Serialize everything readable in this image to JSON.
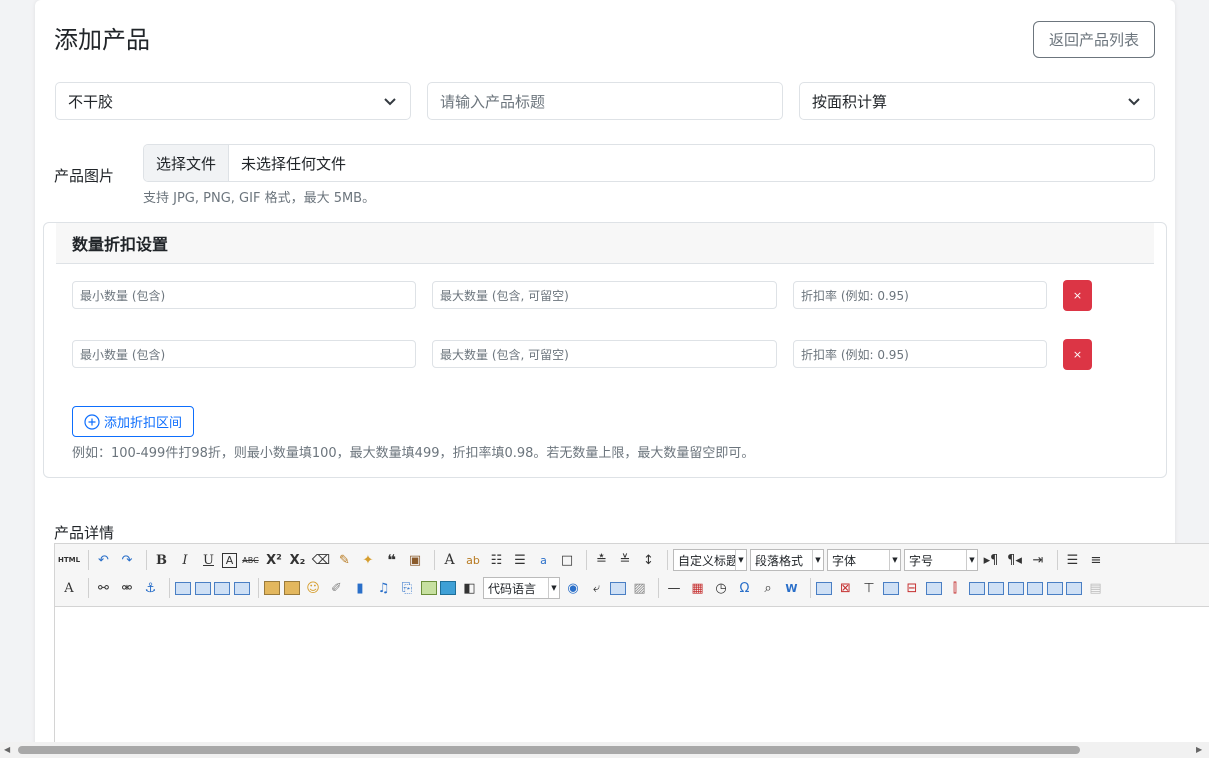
{
  "page": {
    "title": "添加产品",
    "back_button": "返回产品列表"
  },
  "form": {
    "category_select": "不干胶",
    "title_input_placeholder": "请输入产品标题",
    "pricing_select": "按面积计算",
    "image_label": "产品图片",
    "file_button": "选择文件",
    "file_status": "未选择任何文件",
    "file_hint": "支持 JPG, PNG, GIF 格式，最大 5MB。"
  },
  "discount": {
    "header": "数量折扣设置",
    "rows": [
      {
        "min_placeholder": "最小数量 (包含)",
        "max_placeholder": "最大数量 (包含, 可留空)",
        "rate_placeholder": "折扣率 (例如: 0.95)",
        "delete": "×"
      },
      {
        "min_placeholder": "最小数量 (包含)",
        "max_placeholder": "最大数量 (包含, 可留空)",
        "rate_placeholder": "折扣率 (例如: 0.95)",
        "delete": "×"
      }
    ],
    "add_button": "添加折扣区间",
    "example": "例如：100-499件打98折，则最小数量填100，最大数量填499，折扣率填0.98。若无数量上限，最大数量留空即可。"
  },
  "detail": {
    "label": "产品详情",
    "toolbar": {
      "html_label": "HTML",
      "custom_heading": "自定义标题",
      "paragraph": "段落格式",
      "font_family": "字体",
      "font_size": "字号",
      "code_language": "代码语言"
    }
  },
  "colors": {
    "primary": "#0d6efd",
    "danger": "#dc3545",
    "secondary": "#6c757d"
  }
}
